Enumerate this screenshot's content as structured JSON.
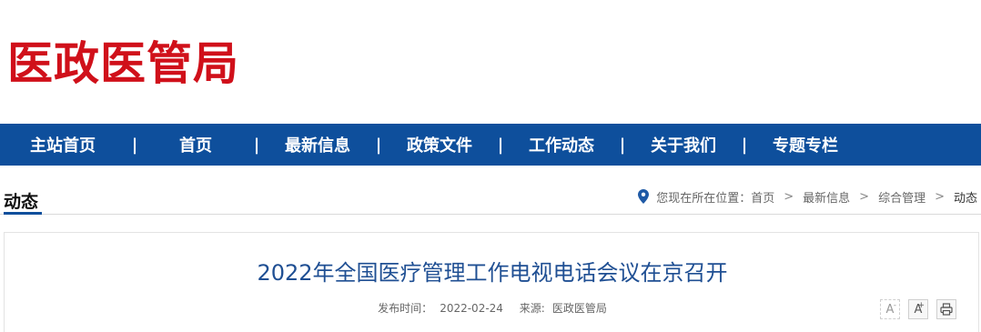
{
  "header": {
    "logo_text": "医政医管局"
  },
  "nav": {
    "items": [
      {
        "label": "主站首页"
      },
      {
        "label": "首页"
      },
      {
        "label": "最新信息"
      },
      {
        "label": "政策文件"
      },
      {
        "label": "工作动态"
      },
      {
        "label": "关于我们"
      },
      {
        "label": "专题专栏"
      }
    ],
    "separator": "|"
  },
  "section": {
    "title": "动态"
  },
  "breadcrumb": {
    "prefix": "您现在所在位置：",
    "items": [
      "首页",
      "最新信息",
      "综合管理",
      "动态"
    ],
    "separator": ">"
  },
  "article": {
    "title": "2022年全国医疗管理工作电视电话会议在京召开",
    "publish_label": "发布时间：",
    "publish_date": "2022-02-24",
    "source_label": "来源:",
    "source": "医政医管局"
  },
  "tools": {
    "font_smaller": "A",
    "font_larger": "A",
    "font_smaller_mark": "-",
    "font_larger_mark": "+"
  },
  "colors": {
    "brand_red": "#d0101a",
    "nav_blue": "#0e4f9c",
    "title_blue": "#1f4f93"
  }
}
